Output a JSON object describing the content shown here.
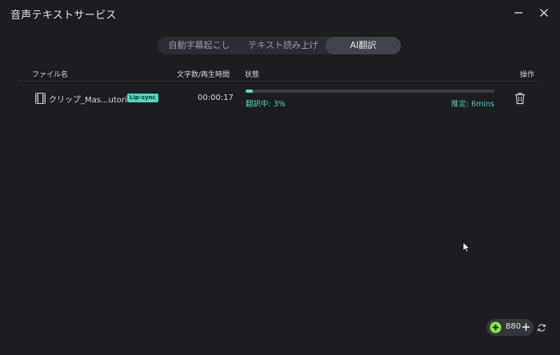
{
  "window": {
    "title": "音声テキストサービス"
  },
  "tabs": [
    {
      "label": "自動字幕起こし",
      "active": false
    },
    {
      "label": "テキスト読み上げ",
      "active": false
    },
    {
      "label": "AI翻訳",
      "active": true
    }
  ],
  "table": {
    "columns": {
      "file": "ファイル名",
      "duration": "文字数/再生時間",
      "status": "状態",
      "actions": "操作"
    },
    "rows": [
      {
        "file_name": "クリップ_Mas...utorial!",
        "badge": "Lip-sync",
        "duration": "00:00:17",
        "progress_label": "翻訳中: 3%",
        "progress": 0.03,
        "eta": "推定: 6mins",
        "file_icon": "film-icon",
        "action_icon": "trash-icon"
      }
    ]
  },
  "credits": {
    "count": "880",
    "coin_icon": "plus-coin-icon",
    "add_icon": "plus-icon"
  },
  "colors": {
    "background": "#1b1d21",
    "accent": "#5fe0c8",
    "badge": "#55d6c0"
  }
}
